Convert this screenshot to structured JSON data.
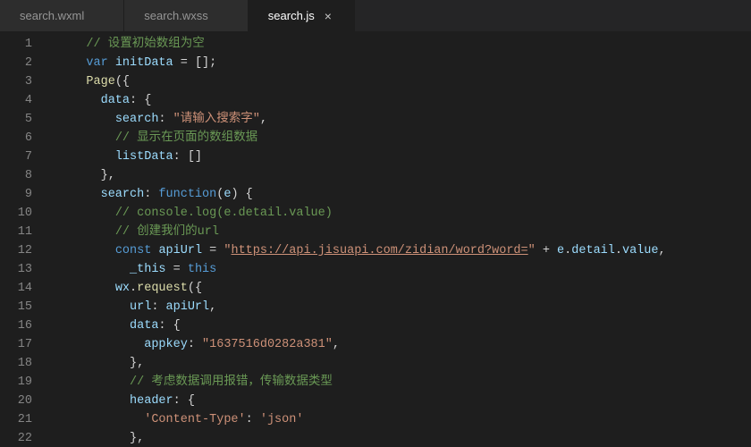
{
  "tabs": [
    {
      "label": "search.wxml",
      "active": false
    },
    {
      "label": "search.wxss",
      "active": false
    },
    {
      "label": "search.js",
      "active": true
    }
  ],
  "closeGlyph": "×",
  "gutter": [
    "1",
    "2",
    "3",
    "4",
    "5",
    "6",
    "7",
    "8",
    "9",
    "10",
    "11",
    "12",
    "13",
    "14",
    "15",
    "16",
    "17",
    "18",
    "19",
    "20",
    "21",
    "22"
  ],
  "lines": [
    [
      {
        "cls": "tok-plain",
        "t": "    "
      },
      {
        "cls": "tok-comment",
        "t": "// 设置初始数组为空"
      }
    ],
    [
      {
        "cls": "tok-plain",
        "t": "    "
      },
      {
        "cls": "tok-keyword",
        "t": "var"
      },
      {
        "cls": "tok-plain",
        "t": " "
      },
      {
        "cls": "tok-ident",
        "t": "initData"
      },
      {
        "cls": "tok-plain",
        "t": " = [];"
      }
    ],
    [
      {
        "cls": "tok-plain",
        "t": "    "
      },
      {
        "cls": "tok-func",
        "t": "Page"
      },
      {
        "cls": "tok-plain",
        "t": "({"
      }
    ],
    [
      {
        "cls": "tok-plain",
        "t": "      "
      },
      {
        "cls": "tok-ident",
        "t": "data"
      },
      {
        "cls": "tok-plain",
        "t": ": {"
      }
    ],
    [
      {
        "cls": "tok-plain",
        "t": "        "
      },
      {
        "cls": "tok-ident",
        "t": "search"
      },
      {
        "cls": "tok-plain",
        "t": ": "
      },
      {
        "cls": "tok-string",
        "t": "\"请输入搜索字\""
      },
      {
        "cls": "tok-plain",
        "t": ","
      }
    ],
    [
      {
        "cls": "tok-plain",
        "t": "        "
      },
      {
        "cls": "tok-comment",
        "t": "// 显示在页面的数组数据"
      }
    ],
    [
      {
        "cls": "tok-plain",
        "t": "        "
      },
      {
        "cls": "tok-ident",
        "t": "listData"
      },
      {
        "cls": "tok-plain",
        "t": ": []"
      }
    ],
    [
      {
        "cls": "tok-plain",
        "t": "      },"
      }
    ],
    [
      {
        "cls": "tok-plain",
        "t": "      "
      },
      {
        "cls": "tok-ident",
        "t": "search"
      },
      {
        "cls": "tok-plain",
        "t": ": "
      },
      {
        "cls": "tok-keyword",
        "t": "function"
      },
      {
        "cls": "tok-plain",
        "t": "("
      },
      {
        "cls": "tok-ident",
        "t": "e"
      },
      {
        "cls": "tok-plain",
        "t": ") {"
      }
    ],
    [
      {
        "cls": "tok-plain",
        "t": "        "
      },
      {
        "cls": "tok-comment",
        "t": "// console.log(e.detail.value)"
      }
    ],
    [
      {
        "cls": "tok-plain",
        "t": "        "
      },
      {
        "cls": "tok-comment",
        "t": "// 创建我们的url"
      }
    ],
    [
      {
        "cls": "tok-plain",
        "t": "        "
      },
      {
        "cls": "tok-keyword",
        "t": "const"
      },
      {
        "cls": "tok-plain",
        "t": " "
      },
      {
        "cls": "tok-ident",
        "t": "apiUrl"
      },
      {
        "cls": "tok-plain",
        "t": " = "
      },
      {
        "cls": "tok-string",
        "t": "\""
      },
      {
        "cls": "tok-url",
        "t": "https://api.jisuapi.com/zidian/word?word="
      },
      {
        "cls": "tok-string",
        "t": "\""
      },
      {
        "cls": "tok-plain",
        "t": " + "
      },
      {
        "cls": "tok-ident",
        "t": "e"
      },
      {
        "cls": "tok-plain",
        "t": "."
      },
      {
        "cls": "tok-ident",
        "t": "detail"
      },
      {
        "cls": "tok-plain",
        "t": "."
      },
      {
        "cls": "tok-ident",
        "t": "value"
      },
      {
        "cls": "tok-plain",
        "t": ","
      }
    ],
    [
      {
        "cls": "tok-plain",
        "t": "          "
      },
      {
        "cls": "tok-ident",
        "t": "_this"
      },
      {
        "cls": "tok-plain",
        "t": " = "
      },
      {
        "cls": "tok-keyword",
        "t": "this"
      }
    ],
    [
      {
        "cls": "tok-plain",
        "t": "        "
      },
      {
        "cls": "tok-ident",
        "t": "wx"
      },
      {
        "cls": "tok-plain",
        "t": "."
      },
      {
        "cls": "tok-func",
        "t": "request"
      },
      {
        "cls": "tok-plain",
        "t": "({"
      }
    ],
    [
      {
        "cls": "tok-plain",
        "t": "          "
      },
      {
        "cls": "tok-ident",
        "t": "url"
      },
      {
        "cls": "tok-plain",
        "t": ": "
      },
      {
        "cls": "tok-ident",
        "t": "apiUrl"
      },
      {
        "cls": "tok-plain",
        "t": ","
      }
    ],
    [
      {
        "cls": "tok-plain",
        "t": "          "
      },
      {
        "cls": "tok-ident",
        "t": "data"
      },
      {
        "cls": "tok-plain",
        "t": ": {"
      }
    ],
    [
      {
        "cls": "tok-plain",
        "t": "            "
      },
      {
        "cls": "tok-ident",
        "t": "appkey"
      },
      {
        "cls": "tok-plain",
        "t": ": "
      },
      {
        "cls": "tok-string",
        "t": "\"1637516d0282a381\""
      },
      {
        "cls": "tok-plain",
        "t": ","
      }
    ],
    [
      {
        "cls": "tok-plain",
        "t": "          },"
      }
    ],
    [
      {
        "cls": "tok-plain",
        "t": "          "
      },
      {
        "cls": "tok-comment",
        "t": "// 考虑数据调用报错，传输数据类型"
      }
    ],
    [
      {
        "cls": "tok-plain",
        "t": "          "
      },
      {
        "cls": "tok-ident",
        "t": "header"
      },
      {
        "cls": "tok-plain",
        "t": ": {"
      }
    ],
    [
      {
        "cls": "tok-plain",
        "t": "            "
      },
      {
        "cls": "tok-string",
        "t": "'Content-Type'"
      },
      {
        "cls": "tok-plain",
        "t": ": "
      },
      {
        "cls": "tok-string",
        "t": "'json'"
      }
    ],
    [
      {
        "cls": "tok-plain",
        "t": "          },"
      }
    ]
  ]
}
